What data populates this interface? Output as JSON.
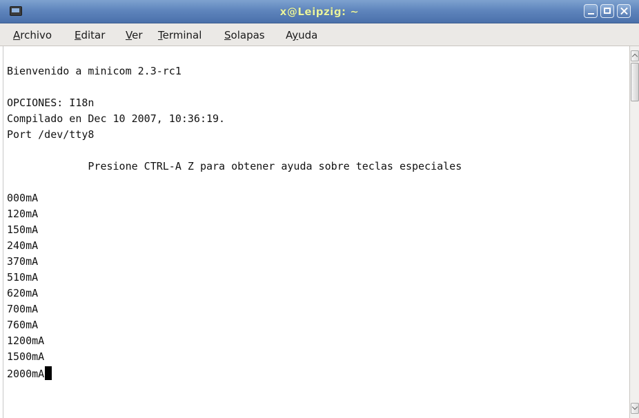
{
  "window": {
    "title": "x@Leipzig: ~"
  },
  "menu": [
    {
      "mnemonic": "A",
      "rest": "rchivo"
    },
    {
      "mnemonic": "E",
      "rest": "ditar"
    },
    {
      "mnemonic": "V",
      "rest": "er"
    },
    {
      "mnemonic": "T",
      "rest": "erminal"
    },
    {
      "mnemonic": "S",
      "rest": "olapas"
    },
    {
      "pre": "A",
      "mnemonic": "y",
      "rest": "uda"
    }
  ],
  "terminal": {
    "lines": [
      "Bienvenido a minicom 2.3-rc1",
      "",
      "OPCIONES: I18n",
      "Compilado en Dec 10 2007, 10:36:19.",
      "Port /dev/tty8",
      "",
      "             Presione CTRL-A Z para obtener ayuda sobre teclas especiales",
      "",
      "000mA",
      "120mA",
      "150mA",
      "240mA",
      "370mA",
      "510mA",
      "620mA",
      "700mA",
      "760mA",
      "1200mA",
      "1500mA",
      "2000mA"
    ]
  },
  "icons": {
    "window_icon": "terminal-icon",
    "minimize": "minimize-icon",
    "maximize": "maximize-icon",
    "close": "close-icon"
  },
  "colors": {
    "titlebar": "#5f85bd",
    "title_text": "#e8f3a0",
    "menubar": "#ebe9e6",
    "terminal_bg": "#ffffff",
    "terminal_fg": "#111111"
  }
}
